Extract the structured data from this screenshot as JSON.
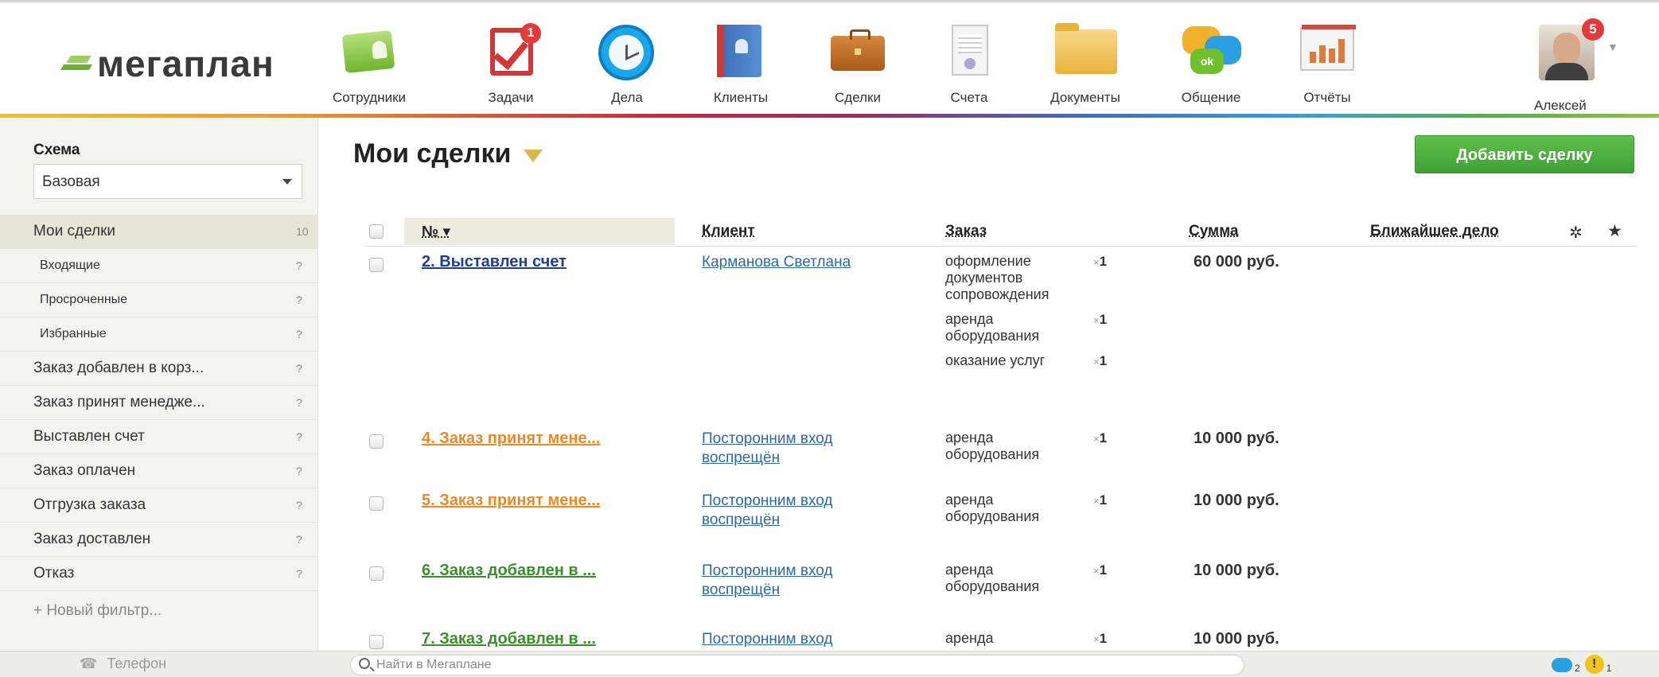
{
  "header": {
    "logo_text": "мегаплан",
    "nav": [
      {
        "label": "Сотрудники",
        "icon": "staff-icon"
      },
      {
        "label": "Задачи",
        "icon": "tasks-icon",
        "badge": "1"
      },
      {
        "label": "Дела",
        "icon": "clock-icon"
      },
      {
        "label": "Клиенты",
        "icon": "clients-icon"
      },
      {
        "label": "Сделки",
        "icon": "briefcase-icon"
      },
      {
        "label": "Счета",
        "icon": "invoice-icon"
      },
      {
        "label": "Документы",
        "icon": "folder-icon"
      },
      {
        "label": "Общение",
        "icon": "chat-icon",
        "icon_text": "ok"
      },
      {
        "label": "Отчёты",
        "icon": "report-icon"
      }
    ],
    "user": {
      "name": "Алексей",
      "badge": "5"
    }
  },
  "sidebar": {
    "schema_label": "Схема",
    "schema_value": "Базовая",
    "filters": [
      {
        "name": "Мои сделки",
        "count": "10",
        "active": true,
        "sub": false
      },
      {
        "name": "Входящие",
        "count": "?",
        "sub": true
      },
      {
        "name": "Просроченные",
        "count": "?",
        "sub": true
      },
      {
        "name": "Избранные",
        "count": "?",
        "sub": true
      },
      {
        "name": "Заказ добавлен в корз...",
        "count": "?",
        "sub": false
      },
      {
        "name": "Заказ принят менедже...",
        "count": "?",
        "sub": false
      },
      {
        "name": "Выставлен счет",
        "count": "?",
        "sub": false
      },
      {
        "name": "Заказ оплачен",
        "count": "?",
        "sub": false
      },
      {
        "name": "Отгрузка заказа",
        "count": "?",
        "sub": false
      },
      {
        "name": "Заказ доставлен",
        "count": "?",
        "sub": false
      },
      {
        "name": "Отказ",
        "count": "?",
        "sub": false
      }
    ],
    "new_filter": "+ Новый фильтр..."
  },
  "main": {
    "title": "Мои сделки",
    "add_button": "Добавить сделку",
    "columns": {
      "num": "№ ▾",
      "client": "Клиент",
      "order": "Заказ",
      "sum": "Сумма",
      "next_action": "Ближайшее дело",
      "settings": "✲",
      "star": "★"
    },
    "rows": [
      {
        "deal": "2. Выставлен счет",
        "deal_color": "#1f3f8f",
        "client": "Карманова Светлана",
        "items": [
          {
            "name": "оформление документов сопровождения",
            "x": "×",
            "qty": "1"
          },
          {
            "name": "аренда оборудования",
            "x": "×",
            "qty": "1"
          },
          {
            "name": "оказание услуг",
            "x": "×",
            "qty": "1"
          }
        ],
        "sum": "60 000 руб."
      },
      {
        "deal": "4. Заказ принят мене...",
        "deal_color": "#e8892a",
        "client": "Посторонним вход воспрещён",
        "items": [
          {
            "name": "аренда оборудования",
            "x": "×",
            "qty": "1"
          }
        ],
        "sum": "10 000 руб."
      },
      {
        "deal": "5. Заказ принят мене...",
        "deal_color": "#e8892a",
        "client": "Посторонним вход воспрещён",
        "items": [
          {
            "name": "аренда оборудования",
            "x": "×",
            "qty": "1"
          }
        ],
        "sum": "10 000 руб."
      },
      {
        "deal": "6. Заказ добавлен в ...",
        "deal_color": "#3a8f2a",
        "client": "Посторонним вход воспрещён",
        "items": [
          {
            "name": "аренда оборудования",
            "x": "×",
            "qty": "1"
          }
        ],
        "sum": "10 000 руб."
      },
      {
        "deal": "7. Заказ добавлен в ...",
        "deal_color": "#3a8f2a",
        "client": "Посторонним вход",
        "items": [
          {
            "name": "аренда",
            "x": "×",
            "qty": "1"
          }
        ],
        "sum": "10 000 руб."
      }
    ]
  },
  "bottombar": {
    "phone": "Телефон",
    "search_placeholder": "Найти в Мегаплане",
    "chat_count": "2",
    "warn_icon_text": "!",
    "warn_count": "1"
  }
}
